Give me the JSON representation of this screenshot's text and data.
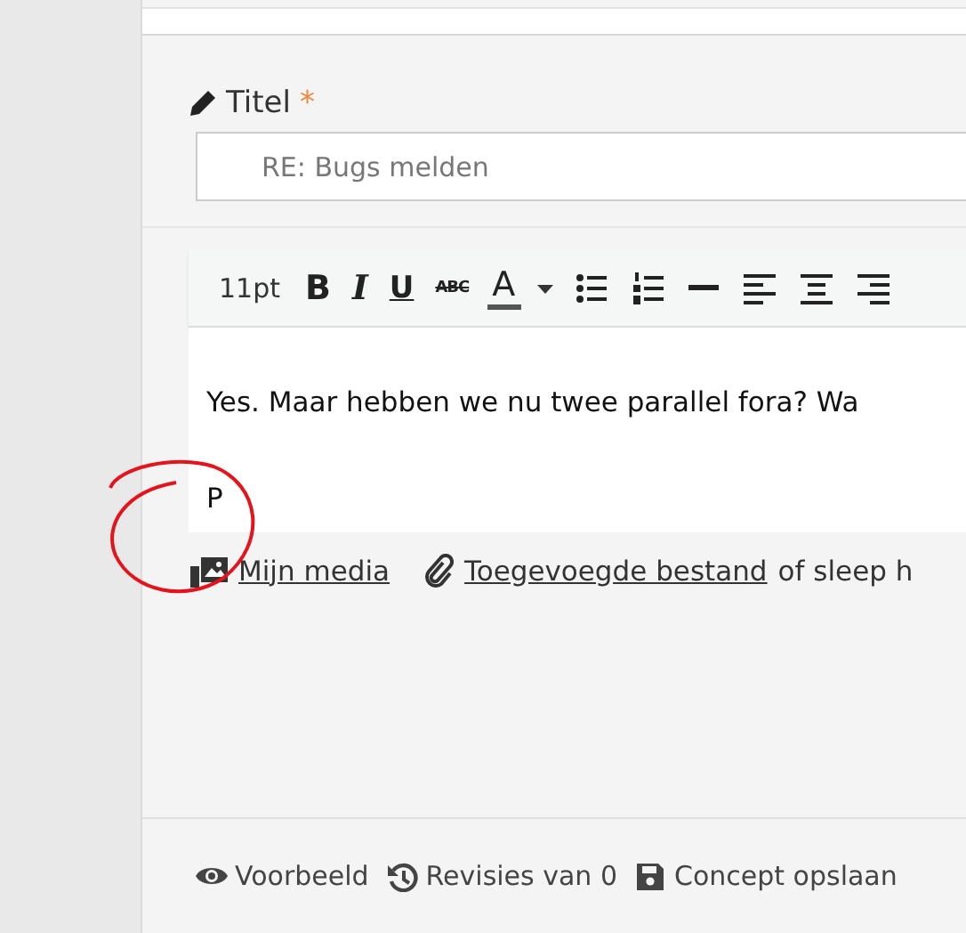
{
  "title_field": {
    "label": "Titel",
    "required_mark": "*",
    "value": "RE: Bugs melden"
  },
  "toolbar": [
    {
      "kind": "text",
      "label": "11pt"
    },
    {
      "kind": "bold",
      "label": "B"
    },
    {
      "kind": "italic",
      "label": "I"
    },
    {
      "kind": "underline",
      "label": "U"
    },
    {
      "kind": "strike",
      "label": "ABC"
    },
    {
      "kind": "color",
      "label": "A"
    },
    {
      "kind": "caret"
    },
    {
      "kind": "bullets"
    },
    {
      "kind": "numbers"
    },
    {
      "kind": "rule"
    },
    {
      "kind": "align-left"
    },
    {
      "kind": "align-center"
    },
    {
      "kind": "align-right"
    }
  ],
  "editor": {
    "paragraphs": [
      "Yes. Maar hebben we nu twee parallel fora? Wa",
      "P"
    ]
  },
  "attachments": {
    "media_link": "Mijn media",
    "files_link": "Toegevoegde bestand",
    "hint": "of sleep h"
  },
  "actions": [
    {
      "kind": "preview",
      "label": "Voorbeeld"
    },
    {
      "kind": "revisions",
      "label": "Revisies van 0"
    },
    {
      "kind": "save",
      "label": "Concept opslaan"
    }
  ]
}
